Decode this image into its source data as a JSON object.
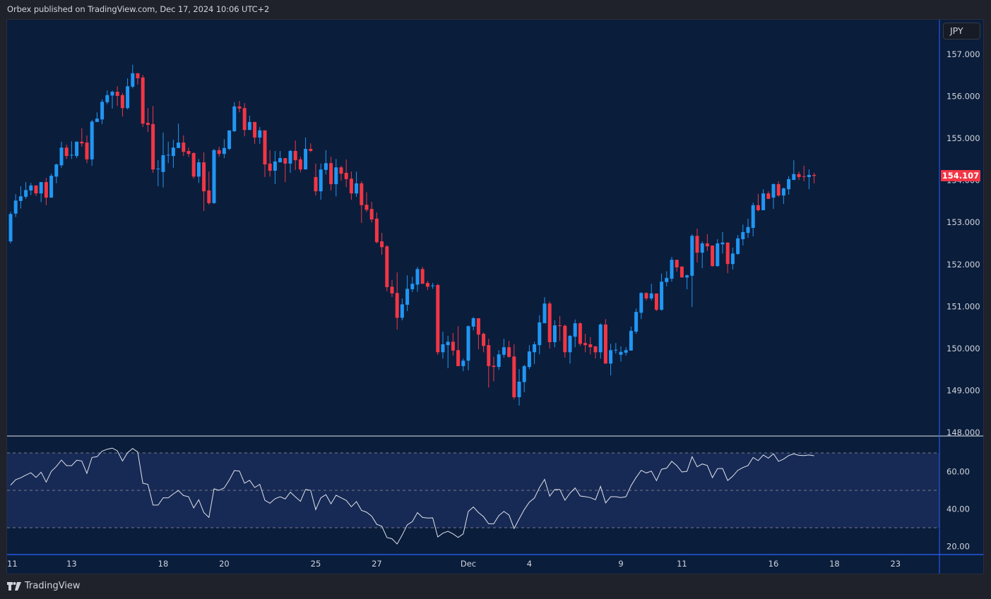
{
  "header": {
    "published": "Orbex published on TradingView.com, Dec 17, 2024 10:06 UTC+2"
  },
  "currency_button": "JPY",
  "footer": {
    "brand": "TradingView",
    "logo_icon": "tradingview-logo-icon"
  },
  "colors": {
    "up": "#2196f3",
    "down": "#f23645",
    "background": "#0a1d3b",
    "rsi_line": "#e0e3eb",
    "rsi_band": "#172a55",
    "axis_line": "#2962ff"
  },
  "chart_data": [
    {
      "type": "candlestick",
      "timeframe_note": "",
      "y_axis": {
        "ticks": [
          "157.000",
          "156.000",
          "155.000",
          "154.000",
          "153.000",
          "152.000",
          "151.000",
          "150.000",
          "149.000",
          "148.000"
        ],
        "range": [
          148,
          157.8
        ]
      },
      "last_price": "154.107",
      "x_ticks": [
        {
          "label": "11",
          "bar": 0
        },
        {
          "label": "13",
          "bar": 12
        },
        {
          "label": "18",
          "bar": 30
        },
        {
          "label": "20",
          "bar": 42
        },
        {
          "label": "25",
          "bar": 60
        },
        {
          "label": "27",
          "bar": 72
        },
        {
          "label": "Dec",
          "bar": 90
        },
        {
          "label": "4",
          "bar": 102
        },
        {
          "label": "9",
          "bar": 120
        },
        {
          "label": "11",
          "bar": 132
        },
        {
          "label": "16",
          "bar": 150
        },
        {
          "label": "18",
          "bar": 162
        },
        {
          "label": "23",
          "bar": 174
        }
      ],
      "ohlc_columns": [
        "open",
        "high",
        "low",
        "close"
      ],
      "candles": [
        [
          152.55,
          153.25,
          152.5,
          153.2
        ],
        [
          153.21,
          153.67,
          153.13,
          153.52
        ],
        [
          153.51,
          153.86,
          153.33,
          153.62
        ],
        [
          153.61,
          153.96,
          153.56,
          153.77
        ],
        [
          153.76,
          153.94,
          153.65,
          153.88
        ],
        [
          153.88,
          153.88,
          153.63,
          153.69
        ],
        [
          153.69,
          153.96,
          153.48,
          153.96
        ],
        [
          153.96,
          154.06,
          153.41,
          153.59
        ],
        [
          153.59,
          154.16,
          153.59,
          154.11
        ],
        [
          154.09,
          154.4,
          153.93,
          154.38
        ],
        [
          154.36,
          154.92,
          154.3,
          154.78
        ],
        [
          154.78,
          154.85,
          154.51,
          154.58
        ],
        [
          154.6,
          154.93,
          154.51,
          154.61
        ],
        [
          154.58,
          154.93,
          154.53,
          154.92
        ],
        [
          154.92,
          155.24,
          154.8,
          154.88
        ],
        [
          154.9,
          155.07,
          154.41,
          154.5
        ],
        [
          154.5,
          155.44,
          154.35,
          155.4
        ],
        [
          155.39,
          155.62,
          155.39,
          155.47
        ],
        [
          155.45,
          155.93,
          155.34,
          155.87
        ],
        [
          155.86,
          156.14,
          155.81,
          156.03
        ],
        [
          156.02,
          156.14,
          155.71,
          156.11
        ],
        [
          156.11,
          156.24,
          155.77,
          156.01
        ],
        [
          156.03,
          156.08,
          155.52,
          155.72
        ],
        [
          155.72,
          156.43,
          155.69,
          156.24
        ],
        [
          156.23,
          156.75,
          156.19,
          156.55
        ],
        [
          156.55,
          156.55,
          156.28,
          156.43
        ],
        [
          156.45,
          156.51,
          155.27,
          155.35
        ],
        [
          155.37,
          155.72,
          155.15,
          155.32
        ],
        [
          155.34,
          155.77,
          154.18,
          154.26
        ],
        [
          154.27,
          154.48,
          153.86,
          154.28
        ],
        [
          154.2,
          155.14,
          153.83,
          154.6
        ],
        [
          154.6,
          154.92,
          154.41,
          154.61
        ],
        [
          154.58,
          154.97,
          154.3,
          154.78
        ],
        [
          154.77,
          155.35,
          154.77,
          154.9
        ],
        [
          154.9,
          155.07,
          154.58,
          154.68
        ],
        [
          154.7,
          154.78,
          154.56,
          154.63
        ],
        [
          154.65,
          154.67,
          154.04,
          154.09
        ],
        [
          154.09,
          154.51,
          153.94,
          154.43
        ],
        [
          154.43,
          154.67,
          153.27,
          153.74
        ],
        [
          153.76,
          154.21,
          153.42,
          153.46
        ],
        [
          153.46,
          154.75,
          153.44,
          154.72
        ],
        [
          154.72,
          154.8,
          154.56,
          154.63
        ],
        [
          154.63,
          154.98,
          154.53,
          154.77
        ],
        [
          154.75,
          155.19,
          154.72,
          155.19
        ],
        [
          155.17,
          155.86,
          155.15,
          155.76
        ],
        [
          155.76,
          155.89,
          155.62,
          155.71
        ],
        [
          155.72,
          155.84,
          155.05,
          155.2
        ],
        [
          155.2,
          155.54,
          155.2,
          155.39
        ],
        [
          155.39,
          155.39,
          154.87,
          155.02
        ],
        [
          155.02,
          155.27,
          154.87,
          155.19
        ],
        [
          155.19,
          155.19,
          154.08,
          154.38
        ],
        [
          154.4,
          154.72,
          154.09,
          154.23
        ],
        [
          154.23,
          154.7,
          153.91,
          154.45
        ],
        [
          154.43,
          154.7,
          154.43,
          154.53
        ],
        [
          154.53,
          154.53,
          153.96,
          154.4
        ],
        [
          154.4,
          154.73,
          154.18,
          154.7
        ],
        [
          154.7,
          154.95,
          154.25,
          154.48
        ],
        [
          154.5,
          154.56,
          154.19,
          154.26
        ],
        [
          154.26,
          155.02,
          154.26,
          154.75
        ],
        [
          154.75,
          154.88,
          154.67,
          154.7
        ],
        [
          154.08,
          154.4,
          153.64,
          153.74
        ],
        [
          153.74,
          154.4,
          153.54,
          154.26
        ],
        [
          154.25,
          154.72,
          154.14,
          154.41
        ],
        [
          154.41,
          154.56,
          153.76,
          153.91
        ],
        [
          153.91,
          154.51,
          153.62,
          154.31
        ],
        [
          154.31,
          154.35,
          153.99,
          154.16
        ],
        [
          154.18,
          154.5,
          153.84,
          154.03
        ],
        [
          154.04,
          154.21,
          153.54,
          153.69
        ],
        [
          153.69,
          154.21,
          153.61,
          153.93
        ],
        [
          153.93,
          153.98,
          152.99,
          153.41
        ],
        [
          153.42,
          153.72,
          153.25,
          153.3
        ],
        [
          153.32,
          153.49,
          153.0,
          153.07
        ],
        [
          153.09,
          153.24,
          152.5,
          152.53
        ],
        [
          152.55,
          152.75,
          152.23,
          152.41
        ],
        [
          152.43,
          152.46,
          151.36,
          151.46
        ],
        [
          151.47,
          151.63,
          151.22,
          151.31
        ],
        [
          151.32,
          151.81,
          150.45,
          150.73
        ],
        [
          150.73,
          151.19,
          150.67,
          151.05
        ],
        [
          151.04,
          151.74,
          150.89,
          151.42
        ],
        [
          151.41,
          151.71,
          151.34,
          151.54
        ],
        [
          151.52,
          151.94,
          151.35,
          151.89
        ],
        [
          151.89,
          151.94,
          151.54,
          151.54
        ],
        [
          151.56,
          151.61,
          151.39,
          151.47
        ],
        [
          151.49,
          151.56,
          151.42,
          151.5
        ],
        [
          151.51,
          151.54,
          149.85,
          149.91
        ],
        [
          149.91,
          150.4,
          149.76,
          150.1
        ],
        [
          150.08,
          150.3,
          149.53,
          150.16
        ],
        [
          150.16,
          150.37,
          149.83,
          149.95
        ],
        [
          149.96,
          150.53,
          149.58,
          149.58
        ],
        [
          149.58,
          149.76,
          149.46,
          149.71
        ],
        [
          149.71,
          150.55,
          149.48,
          150.53
        ],
        [
          150.52,
          150.75,
          150.43,
          150.72
        ],
        [
          150.72,
          150.72,
          149.98,
          150.33
        ],
        [
          150.35,
          150.38,
          149.91,
          150.06
        ],
        [
          150.08,
          150.23,
          149.07,
          149.58
        ],
        [
          149.59,
          149.8,
          149.22,
          149.56
        ],
        [
          149.56,
          149.96,
          149.49,
          149.86
        ],
        [
          149.85,
          150.23,
          149.78,
          150.03
        ],
        [
          150.03,
          150.18,
          149.78,
          149.8
        ],
        [
          149.81,
          150.1,
          148.79,
          148.84
        ],
        [
          148.84,
          149.51,
          148.64,
          149.21
        ],
        [
          149.2,
          149.61,
          148.96,
          149.58
        ],
        [
          149.56,
          150.08,
          149.51,
          149.93
        ],
        [
          149.91,
          150.16,
          149.63,
          150.1
        ],
        [
          150.08,
          150.79,
          149.86,
          150.62
        ],
        [
          150.6,
          151.22,
          150.6,
          151.07
        ],
        [
          151.07,
          151.12,
          150.0,
          150.15
        ],
        [
          150.15,
          150.67,
          150.03,
          150.55
        ],
        [
          150.55,
          150.77,
          150.18,
          150.54
        ],
        [
          150.54,
          150.57,
          149.78,
          149.91
        ],
        [
          149.91,
          150.32,
          149.64,
          150.3
        ],
        [
          150.28,
          150.69,
          150.03,
          150.6
        ],
        [
          150.6,
          150.62,
          150.06,
          150.11
        ],
        [
          150.13,
          150.35,
          149.91,
          150.08
        ],
        [
          150.1,
          150.27,
          149.86,
          150.03
        ],
        [
          150.05,
          150.06,
          149.76,
          149.91
        ],
        [
          149.91,
          150.6,
          149.76,
          150.57
        ],
        [
          150.57,
          150.7,
          149.64,
          149.64
        ],
        [
          149.64,
          150.11,
          149.36,
          149.96
        ],
        [
          149.96,
          150.13,
          149.88,
          149.97
        ],
        [
          149.85,
          150.05,
          149.69,
          149.92
        ],
        [
          149.9,
          150.03,
          149.83,
          149.96
        ],
        [
          149.95,
          150.52,
          149.95,
          150.42
        ],
        [
          150.4,
          150.95,
          150.35,
          150.87
        ],
        [
          150.85,
          151.34,
          150.7,
          151.32
        ],
        [
          151.32,
          151.34,
          151.14,
          151.19
        ],
        [
          151.19,
          151.54,
          151.14,
          151.31
        ],
        [
          151.31,
          151.31,
          150.89,
          150.92
        ],
        [
          150.92,
          151.78,
          150.9,
          151.59
        ],
        [
          151.58,
          151.84,
          151.48,
          151.68
        ],
        [
          151.66,
          152.18,
          151.59,
          152.11
        ],
        [
          152.11,
          152.11,
          151.83,
          151.93
        ],
        [
          151.95,
          151.95,
          151.69,
          151.69
        ],
        [
          151.69,
          151.76,
          151.41,
          151.74
        ],
        [
          151.73,
          152.72,
          150.99,
          152.68
        ],
        [
          152.68,
          152.85,
          152.05,
          152.28
        ],
        [
          152.28,
          152.55,
          151.91,
          152.5
        ],
        [
          152.5,
          152.72,
          152.32,
          152.43
        ],
        [
          152.45,
          152.45,
          151.95,
          151.96
        ],
        [
          151.96,
          152.6,
          151.95,
          152.5
        ],
        [
          152.48,
          152.77,
          152.26,
          152.52
        ],
        [
          152.52,
          152.53,
          151.79,
          152.01
        ],
        [
          152.01,
          152.4,
          151.88,
          152.26
        ],
        [
          152.25,
          152.7,
          152.23,
          152.62
        ],
        [
          152.6,
          152.95,
          152.45,
          152.77
        ],
        [
          152.75,
          153.09,
          152.63,
          152.89
        ],
        [
          152.87,
          153.47,
          152.67,
          153.41
        ],
        [
          153.41,
          153.68,
          153.26,
          153.29
        ],
        [
          153.29,
          153.79,
          153.29,
          153.69
        ],
        [
          153.69,
          153.74,
          153.56,
          153.56
        ],
        [
          153.59,
          153.93,
          153.32,
          153.91
        ],
        [
          153.91,
          153.98,
          153.61,
          153.64
        ],
        [
          153.64,
          153.83,
          153.44,
          153.81
        ],
        [
          153.79,
          154.1,
          153.66,
          154.03
        ],
        [
          154.01,
          154.48,
          154.01,
          154.15
        ],
        [
          154.15,
          154.21,
          154.01,
          154.08
        ],
        [
          154.1,
          154.35,
          153.98,
          154.09
        ],
        [
          154.08,
          154.26,
          153.79,
          154.13
        ],
        [
          154.13,
          154.18,
          153.93,
          154.107
        ]
      ]
    },
    {
      "type": "line",
      "indicator": "",
      "y_axis": {
        "ticks": [
          "60.00",
          "40.00",
          "20.00"
        ],
        "range": [
          12,
          81
        ]
      },
      "levels": [
        70,
        50,
        30
      ],
      "values": [
        52.8,
        55.7,
        56.7,
        58.2,
        59.4,
        56.9,
        59.7,
        54.4,
        60.1,
        62.8,
        66.2,
        63.2,
        63.2,
        66.1,
        65.7,
        59.1,
        67.6,
        68.0,
        71.0,
        72.0,
        72.6,
        71.1,
        65.7,
        70.1,
        72.4,
        70.5,
        53.8,
        53.2,
        42.1,
        42.1,
        46.0,
        46.0,
        48.1,
        49.9,
        47.2,
        46.6,
        40.6,
        45.0,
        38.1,
        35.5,
        50.8,
        50.0,
        51.3,
        55.5,
        60.6,
        60.3,
        53.8,
        55.4,
        51.5,
        53.2,
        44.7,
        43.1,
        45.5,
        46.6,
        45.4,
        49.0,
        46.5,
        44.1,
        50.5,
        50.0,
        39.7,
        46.0,
        47.7,
        42.8,
        47.4,
        46.0,
        44.6,
        41.2,
        44.0,
        39.3,
        38.3,
        36.2,
        31.8,
        30.8,
        24.8,
        24.1,
        21.3,
        26.1,
        31.6,
        33.3,
        38.1,
        35.5,
        35.2,
        35.3,
        25.1,
        27.1,
        28.1,
        26.7,
        24.8,
        26.7,
        38.7,
        41.1,
        38.1,
        35.9,
        32.1,
        32.1,
        36.5,
        38.7,
        36.8,
        29.6,
        34.7,
        39.7,
        43.7,
        45.9,
        51.5,
        55.9,
        46.9,
        50.5,
        50.4,
        44.7,
        48.5,
        51.3,
        47.0,
        46.6,
        46.1,
        45.0,
        52.1,
        43.3,
        46.6,
        46.6,
        46.1,
        46.6,
        52.5,
        56.9,
        60.7,
        59.3,
        60.3,
        55.2,
        61.3,
        61.9,
        65.5,
        63.2,
        59.8,
        60.2,
        68.0,
        62.6,
        64.1,
        63.3,
        56.8,
        61.6,
        61.7,
        55.3,
        57.6,
        60.7,
        62.2,
        63.3,
        67.6,
        65.9,
        68.9,
        67.2,
        69.6,
        65.5,
        66.7,
        68.6,
        69.5,
        68.7,
        68.6,
        68.9,
        68.5
      ]
    }
  ]
}
